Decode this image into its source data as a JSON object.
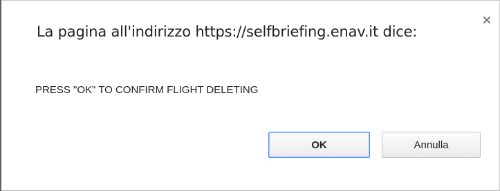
{
  "dialog": {
    "title": "La pagina all'indirizzo https://selfbriefing.enav.it dice:",
    "message": "PRESS \"OK\" TO CONFIRM FLIGHT DELETING",
    "close_icon": "close-icon",
    "buttons": {
      "ok_label": "OK",
      "cancel_label": "Annulla"
    }
  },
  "colors": {
    "focus_border": "#4d90fe",
    "text": "#222222",
    "background": "#ffffff"
  }
}
